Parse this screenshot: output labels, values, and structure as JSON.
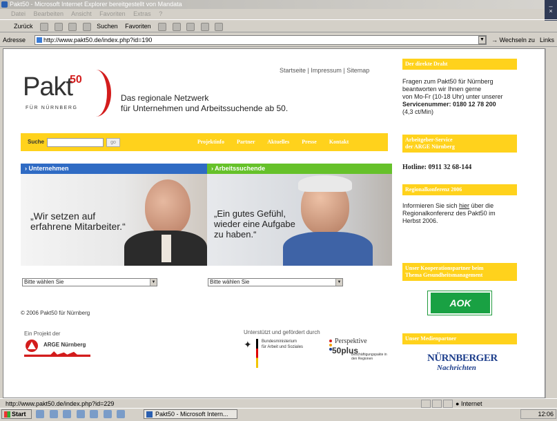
{
  "window": {
    "title": "Pakt50 - Microsoft Internet Explorer bereitgestellt von Mandata",
    "min": "_",
    "close": "×"
  },
  "menu": [
    "Datei",
    "Bearbeiten",
    "Ansicht",
    "Favoriten",
    "Extras",
    "?"
  ],
  "toolbar": {
    "back": "Zurück",
    "search": "Suchen",
    "favorites": "Favoriten"
  },
  "address": {
    "label": "Adresse",
    "url": "http://www.pakt50.de/index.php?id=190",
    "go": "Wechseln zu",
    "links": "Links"
  },
  "site": {
    "logo": {
      "main": "Pakt",
      "sup": "50",
      "sub": "FÜR NÜRNBERG"
    },
    "tagline_1": "Das regionale Netzwerk",
    "tagline_2": "für Unternehmen und Arbeitssuchende ab 50.",
    "toplinks": "Startseite | Impressum | Sitemap",
    "nav": {
      "search_label": "Suche",
      "search_button": "go",
      "items": [
        "Projektinfo",
        "Partner",
        "Aktuelles",
        "Presse",
        "Kontakt"
      ]
    },
    "tabs": {
      "unternehmen": "› Unternehmen",
      "arbeitssuchende": "› Arbeitssuchende"
    },
    "quote_u_1": "„Wir setzen auf",
    "quote_u_2": "erfahrene Mitarbeiter.“",
    "quote_a_1": "„Ein gutes Gefühl,",
    "quote_a_2": "wieder eine Aufgabe",
    "quote_a_3": "zu haben.“",
    "select_u": "Bitte wählen Sie",
    "select_a": "Bitte wählen Sie",
    "copyright": "© 2006 Pakt50 für Nürnberg",
    "project_label": "Ein Projekt der",
    "arge_name": "ARGE Nürnberg",
    "support_label": "Unterstützt und gefördert durch",
    "bmas_1": "Bundesministerium",
    "bmas_2": "für Arbeit und Soziales",
    "p50_title": "Perspektive",
    "p50_num": "50plus",
    "p50_sub": "Beschäftigungspakte in den Regionen"
  },
  "sidebar": {
    "box1": {
      "head": "Der direkte Draht",
      "l1": "Fragen zum Pakt50 für Nürnberg",
      "l2": "beantworten wir Ihnen gerne",
      "l3": "von Mo-Fr (10-18 Uhr) unter unserer",
      "l4": "Servicenummer: 0180 12 78 200",
      "l5": "(4,3 ct/Min)"
    },
    "box2": {
      "head_1": "Arbeitgeber-Service",
      "head_2": "der ARGE Nürnberg",
      "hotline": "Hotline: 0911 32 68-144"
    },
    "box3": {
      "head": "Regionalkonferenz 2006",
      "l1_a": "Informieren Sie sich ",
      "l1_link": "hier",
      "l1_b": " über die",
      "l2": "Regionalkonferenz des Pakt50 im",
      "l3": "Herbst 2006."
    },
    "box4": {
      "head_1": "Unser Kooperationspartner beim",
      "head_2": "Thema Gesundheitsmanagement",
      "aok": "AOK"
    },
    "box5": {
      "head": "Unser Medienpartner",
      "nn_1": "NÜRNBERGER",
      "nn_2": "Nachrichten"
    }
  },
  "status": {
    "text": "http://www.pakt50.de/index.php?id=229",
    "zone": "Internet"
  },
  "taskbar": {
    "start": "Start",
    "task": "Pakt50 - Microsoft Intern...",
    "clock": "12:06"
  }
}
